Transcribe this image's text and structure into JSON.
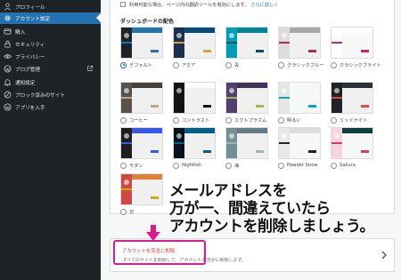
{
  "sidebar": {
    "items": [
      {
        "label": "プロフィール",
        "icon": "person-icon"
      },
      {
        "label": "アカウント設定",
        "icon": "gear-icon",
        "active": true
      },
      {
        "label": "購入",
        "icon": "card-icon"
      },
      {
        "label": "セキュリティ",
        "icon": "lock-icon"
      },
      {
        "label": "プライバシー",
        "icon": "eye-icon"
      },
      {
        "label": "ブログ管理",
        "icon": "wordpress-icon",
        "external": true
      },
      {
        "label": "通知設定",
        "icon": "bell-icon"
      },
      {
        "label": "ブロック済みのサイト",
        "icon": "block-icon"
      },
      {
        "label": "アプリを入手",
        "icon": "wordpress-icon"
      }
    ],
    "colors": {
      "background": "#1d2327",
      "active": "#2271b1"
    }
  },
  "note": {
    "text": "利用可能な場合、ページ内の翻訳ツールを有効にします。",
    "link": "さらに詳しく"
  },
  "dashboard": {
    "title": "ダッシュボードの配色",
    "selected": "デフォルト",
    "schemes": [
      {
        "label": "デフォルト",
        "side": "#1d2327",
        "head": "#2271b1",
        "btn": "#2271b1",
        "body": "#f0f0f1"
      },
      {
        "label": "アクア",
        "side": "#1d2f4f",
        "head": "#044b7f",
        "btn": "#d3a642",
        "body": "#f0f0f1"
      },
      {
        "label": "青",
        "side": "#009eb6",
        "head": "#00819c",
        "btn": "#0d4c60",
        "body": "#f0f0f1"
      },
      {
        "label": "クラシックブルー",
        "side": "#dcdcde",
        "head": "#a7aaad",
        "btn": "#a8324a",
        "body": "#f0f0f1"
      },
      {
        "label": "クラシックブライト",
        "side": "#ffffff",
        "head": "#ffffff",
        "btn": "#c9256e",
        "body": "#f6f7f7"
      },
      {
        "label": "コーヒー",
        "side": "#59524c",
        "head": "#46403c",
        "btn": "#c7a589",
        "body": "#f0f0f1"
      },
      {
        "label": "コントラスト",
        "side": "#101517",
        "head": "#ffffff",
        "btn": "#101517",
        "body": "#f0f0f1"
      },
      {
        "label": "エクトプラズム",
        "side": "#523f6d",
        "head": "#413256",
        "btn": "#a3b745",
        "body": "#f0f0f1"
      },
      {
        "label": "明るい",
        "side": "#e5e5e5",
        "head": "#f6f7f7",
        "btn": "#04a4cc",
        "body": "#f6f7f7"
      },
      {
        "label": "ミッドナイト",
        "side": "#1d2327",
        "head": "#2c3338",
        "btn": "#e14d43",
        "body": "#f0f0f1"
      },
      {
        "label": "モダン",
        "side": "#1e1e1e",
        "head": "#3858e9",
        "btn": "#3858e9",
        "body": "#f0f0f1"
      },
      {
        "label": "Nightfall",
        "side": "#00131c",
        "head": "#016087",
        "btn": "#016087",
        "body": "#f0f0f1"
      },
      {
        "label": "海",
        "side": "#738e96",
        "head": "#627c83",
        "btn": "#9ebaa0",
        "body": "#f0f0f1"
      },
      {
        "label": "Powder Snow",
        "side": "#e8e8e8",
        "head": "#dcdcde",
        "btn": "#1d2327",
        "body": "#f6f7f7"
      },
      {
        "label": "Sakura",
        "side": "#f7d4df",
        "head": "#10403c",
        "btn": "#ce3d6b",
        "body": "#f6f7f7"
      },
      {
        "label": "日",
        "side": "#cf4944",
        "head": "#dd823b",
        "btn": "#ccaf0b",
        "body": "#f0f0f1"
      }
    ]
  },
  "callout": {
    "lines": [
      "メールアドレスを",
      "万が一、間違えていたら",
      "アカウントを削除しましょう。"
    ],
    "highlight_color": "#e0198c"
  },
  "delete": {
    "title": "アカウントを完全に削除",
    "description": "すべてのサイトを削除して、アカウントを完全に削除します。",
    "title_color": "#d63638"
  }
}
